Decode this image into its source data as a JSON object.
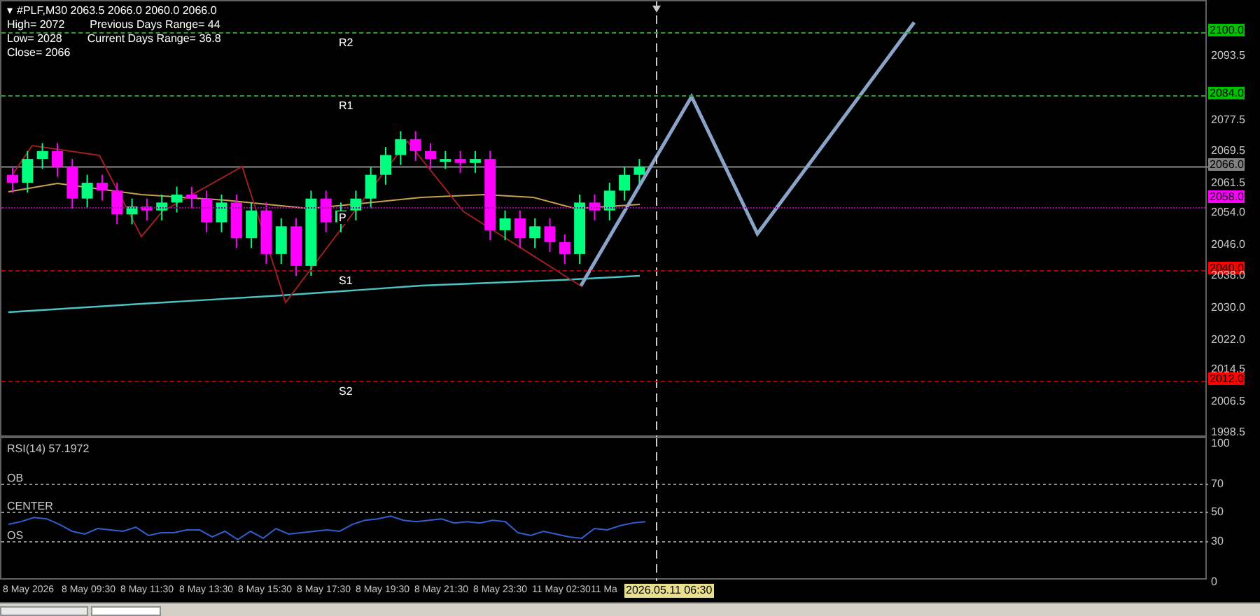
{
  "chart_header": {
    "toggle": "▾",
    "title": "#PLF,M30 2063.5 2066.0 2060.0 2066.0"
  },
  "info_lines": [
    {
      "left": "High= 2072",
      "right": "Previous Days Range= 44"
    },
    {
      "left": "Low= 2028",
      "right": "Current Days Range= 36.8"
    },
    {
      "left": "Close= 2066"
    }
  ],
  "levels": [
    {
      "label": "R2",
      "color": "#2f9a2f"
    },
    {
      "label": "R1",
      "color": "#2f9a2f"
    },
    {
      "label": "P",
      "color": "#a000a0"
    },
    {
      "label": "S1",
      "color": "#b00000"
    },
    {
      "label": "S2",
      "color": "#b00000"
    }
  ],
  "price_axis": [
    {
      "text": "2100.0",
      "kind": "marker",
      "color": "#00c000"
    },
    {
      "text": "2093.5",
      "kind": "tick"
    },
    {
      "text": "2084.0",
      "kind": "marker",
      "color": "#00c000"
    },
    {
      "text": "2077.5",
      "kind": "tick"
    },
    {
      "text": "2069.5",
      "kind": "tick"
    },
    {
      "text": "2066.0",
      "kind": "marker",
      "color": "#808080"
    },
    {
      "text": "2061.5",
      "kind": "tick"
    },
    {
      "text": "2058.0",
      "kind": "marker",
      "color": "#ff00ff"
    },
    {
      "text": "2054.0",
      "kind": "tick"
    },
    {
      "text": "2046.0",
      "kind": "tick"
    },
    {
      "text": "2040.0",
      "kind": "marker",
      "color": "#ff0000"
    },
    {
      "text": "2038.0",
      "kind": "tick"
    },
    {
      "text": "2030.0",
      "kind": "tick"
    },
    {
      "text": "2022.0",
      "kind": "tick"
    },
    {
      "text": "2014.5",
      "kind": "tick"
    },
    {
      "text": "2012.0",
      "kind": "marker",
      "color": "#ff0000"
    },
    {
      "text": "2006.5",
      "kind": "tick"
    },
    {
      "text": "1998.5",
      "kind": "tick"
    }
  ],
  "rsi_panel": {
    "title": "RSI(14) 57.1972",
    "zones": [
      "OB",
      "CENTER",
      "OS"
    ],
    "axis": [
      "100",
      "70",
      "50",
      "30",
      "0"
    ]
  },
  "time_axis": {
    "labels": [
      "8 May 2026",
      "8 May 09:30",
      "8 May 11:30",
      "8 May 13:30",
      "8 May 15:30",
      "8 May 17:30",
      "8 May 19:30",
      "8 May 21:30",
      "8 May 23:30",
      "11 May 02:30",
      "11 Ma"
    ],
    "crosshair_label": "2026.05.11 06:30"
  }
}
